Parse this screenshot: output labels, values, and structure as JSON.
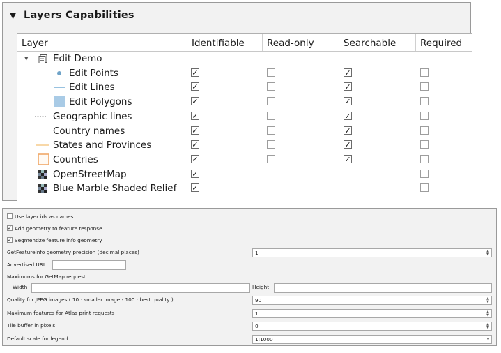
{
  "layers_panel": {
    "title": "Layers Capabilities",
    "columns": {
      "layer": "Layer",
      "identifiable": "Identifiable",
      "read_only": "Read-only",
      "searchable": "Searchable",
      "required": "Required"
    },
    "rows": [
      {
        "label": "Edit Demo",
        "icon": "group-folder-icon",
        "indent": 0,
        "identifiable": null,
        "read_only": null,
        "searchable": null,
        "required": null,
        "expandable": true
      },
      {
        "label": "Edit Points",
        "icon": "point-symbol-icon",
        "indent": 1,
        "identifiable": true,
        "read_only": false,
        "searchable": true,
        "required": false
      },
      {
        "label": "Edit Lines",
        "icon": "line-symbol-icon",
        "indent": 1,
        "identifiable": true,
        "read_only": false,
        "searchable": true,
        "required": false
      },
      {
        "label": "Edit Polygons",
        "icon": "polygon-symbol-icon",
        "indent": 1,
        "identifiable": true,
        "read_only": false,
        "searchable": true,
        "required": false
      },
      {
        "label": "Geographic lines",
        "icon": "dashed-line-icon",
        "indent": 0,
        "identifiable": true,
        "read_only": false,
        "searchable": true,
        "required": false
      },
      {
        "label": "Country names",
        "icon": "",
        "indent": 0,
        "identifiable": true,
        "read_only": false,
        "searchable": true,
        "required": false
      },
      {
        "label": "States and Provinces",
        "icon": "thin-line-icon",
        "indent": 0,
        "identifiable": true,
        "read_only": false,
        "searchable": true,
        "required": false
      },
      {
        "label": "Countries",
        "icon": "outlined-polygon-icon",
        "indent": 0,
        "identifiable": true,
        "read_only": false,
        "searchable": true,
        "required": false
      },
      {
        "label": "OpenStreetMap",
        "icon": "raster-icon",
        "indent": 0,
        "identifiable": true,
        "read_only": null,
        "searchable": null,
        "required": false
      },
      {
        "label": "Blue Marble Shaded Relief",
        "icon": "raster-icon",
        "indent": 0,
        "identifiable": true,
        "read_only": null,
        "searchable": null,
        "required": false
      }
    ]
  },
  "settings": {
    "use_layer_ids": {
      "label": "Use layer ids as names",
      "checked": false
    },
    "add_geometry": {
      "label": "Add geometry to feature response",
      "checked": true
    },
    "segmentize": {
      "label": "Segmentize feature info geometry",
      "checked": true
    },
    "precision": {
      "label": "GetFeatureInfo geometry precision (decimal places)",
      "value": "1"
    },
    "advertised_url": {
      "label": "Advertised URL",
      "value": ""
    },
    "maximums": {
      "label": "Maximums for GetMap request",
      "width_label": "Width",
      "width_value": "",
      "height_label": "Height",
      "height_value": ""
    },
    "jpeg_quality": {
      "label": "Quality for JPEG images ( 10 : smaller image - 100 : best quality )",
      "value": "90"
    },
    "atlas_max": {
      "label": "Maximum features for Atlas print requests",
      "value": "1"
    },
    "tile_buffer": {
      "label": "Tile buffer in pixels",
      "value": "0"
    },
    "legend_scale": {
      "label": "Default scale for legend",
      "value": "1:1000"
    }
  },
  "colors": {
    "point": "#6fa3c8",
    "line": "#7fb2d8",
    "polygon_fill": "#a9cbe6",
    "polygon_border": "#6f9fc6",
    "countries_border": "#f0a868",
    "states_line": "#f3c074"
  }
}
